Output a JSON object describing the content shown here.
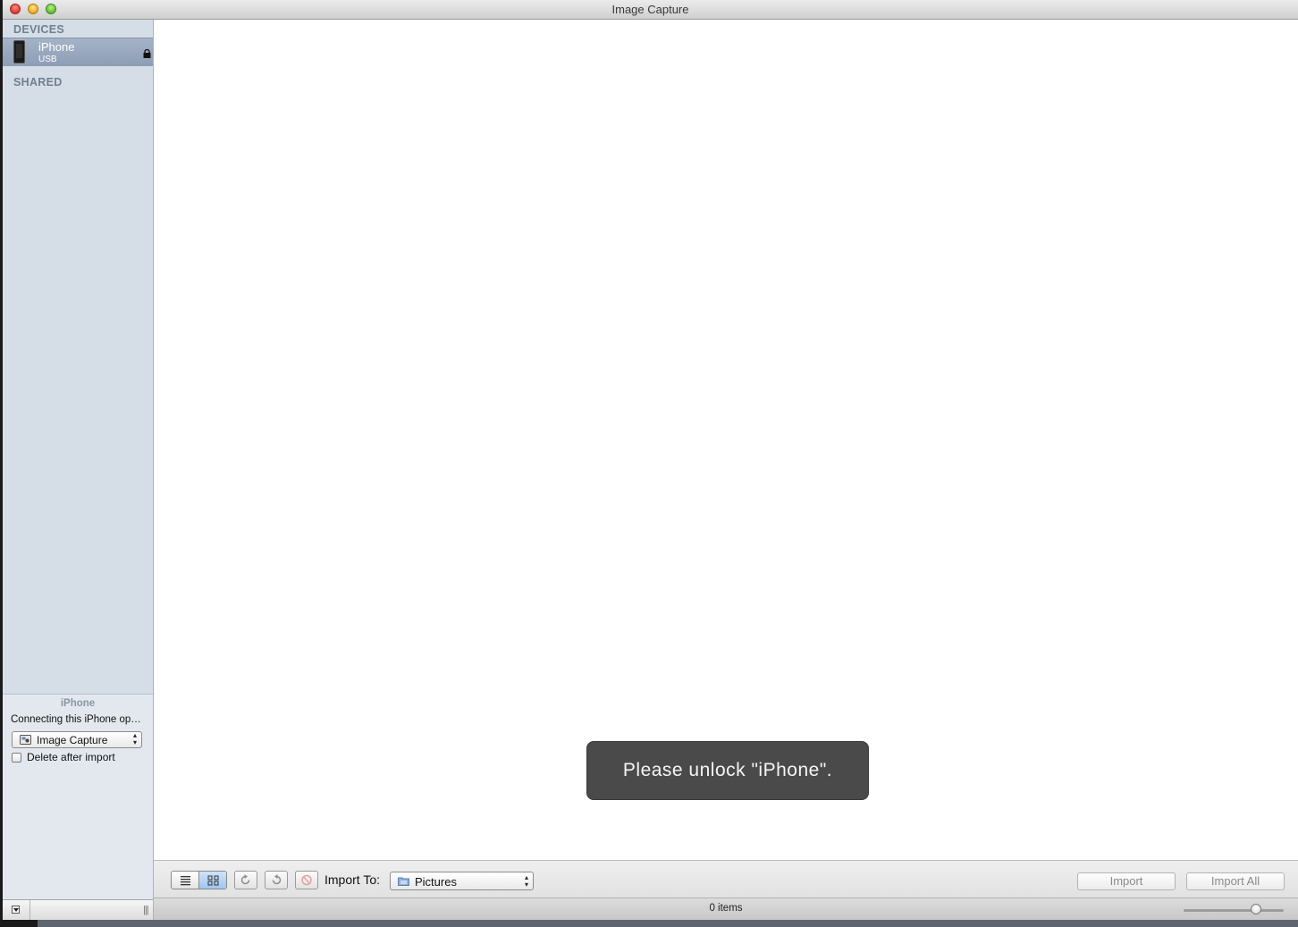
{
  "window": {
    "title": "Image Capture"
  },
  "sidebar": {
    "devices_header": "DEVICES",
    "shared_header": "SHARED",
    "device": {
      "name": "iPhone",
      "connection": "USB",
      "icon": "iphone-icon",
      "locked_icon": "lock-icon"
    }
  },
  "device_panel": {
    "title": "iPhone",
    "description": "Connecting this iPhone opens:",
    "app_popup": {
      "selected": "Image Capture",
      "icon": "image-capture-app-icon"
    },
    "delete_after_import": {
      "label": "Delete after import",
      "checked": false
    }
  },
  "hud": {
    "message": "Please unlock \"iPhone\"."
  },
  "toolbar": {
    "import_to_label": "Import To:",
    "destination_popup": {
      "selected": "Pictures",
      "icon": "folder-icon"
    },
    "view_mode": "icon-view",
    "import_button": "Import",
    "import_all_button": "Import All"
  },
  "statusbar": {
    "item_count": "0 items",
    "thumbnail_size": 0.72
  }
}
